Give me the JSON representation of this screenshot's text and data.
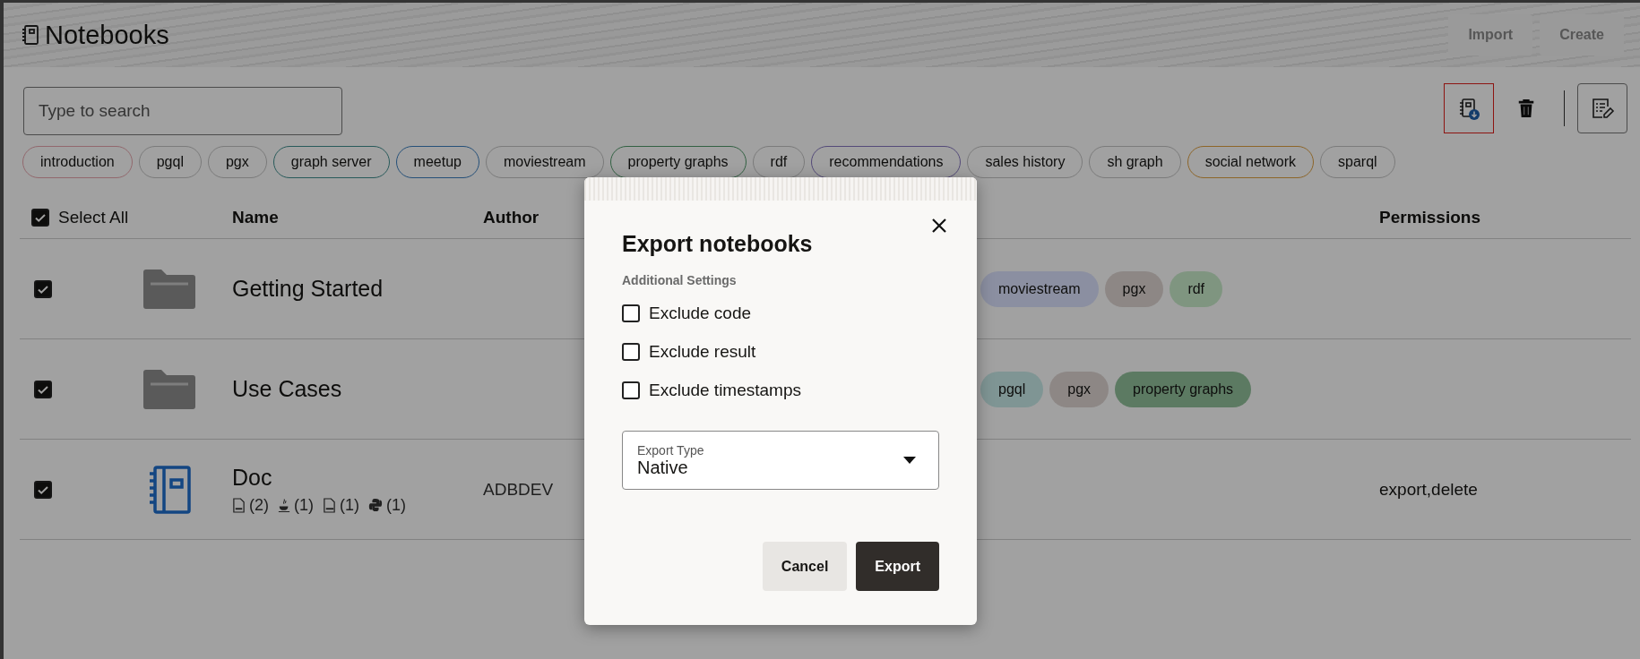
{
  "header": {
    "title": "Notebooks",
    "actions": [
      "Import",
      "Create"
    ]
  },
  "search": {
    "placeholder": "Type to search"
  },
  "toolbar": [
    {
      "kind": "export",
      "highlighted": true
    },
    {
      "kind": "delete",
      "highlighted": false
    },
    {
      "kind": "edit",
      "highlighted": false
    }
  ],
  "filter_tags": [
    {
      "label": "introduction",
      "color": "#92686d"
    },
    {
      "label": "pgql",
      "color": "#7b7b7b"
    },
    {
      "label": "pgx",
      "color": "#7b7b7b"
    },
    {
      "label": "graph server",
      "color": "#285a5a"
    },
    {
      "label": "meetup",
      "color": "#255079"
    },
    {
      "label": "moviestream",
      "color": "#7b7b7b"
    },
    {
      "label": "property graphs",
      "color": "#326142"
    },
    {
      "label": "rdf",
      "color": "#7b7b7b"
    },
    {
      "label": "recommendations",
      "color": "#544a79"
    },
    {
      "label": "sales history",
      "color": "#7b7b7b"
    },
    {
      "label": "sh graph",
      "color": "#7b7b7b"
    },
    {
      "label": "social network",
      "color": "#8d6528"
    },
    {
      "label": "sparql",
      "color": "#7b7b7b"
    }
  ],
  "table": {
    "select_all": {
      "label": "Select All",
      "checked": true
    },
    "columns": [
      "Name",
      "Author",
      "Permissions"
    ],
    "rows": [
      {
        "kind": "folder",
        "checked": true,
        "name": "Getting Started",
        "tags": [
          {
            "label": "moviestream",
            "color": "#8b8fa1"
          },
          {
            "label": "pgx",
            "color": "#8d8785"
          },
          {
            "label": "rdf",
            "color": "#7f9580"
          }
        ]
      },
      {
        "kind": "folder",
        "checked": true,
        "name": "Use Cases",
        "tags": [
          {
            "label": "pgql",
            "color": "#7f9594"
          },
          {
            "label": "pgx",
            "color": "#8d8785"
          },
          {
            "label": "property graphs",
            "color": "#5c7a62"
          }
        ]
      },
      {
        "kind": "notebook",
        "checked": true,
        "name": "Doc",
        "author": "ADBDEV",
        "permissions": "export,delete",
        "languages": [
          {
            "kind": "sql",
            "count": "(2)"
          },
          {
            "kind": "java",
            "count": "(1)"
          },
          {
            "kind": "pgql",
            "count": "(1)"
          },
          {
            "kind": "python",
            "count": "(1)"
          }
        ]
      }
    ]
  },
  "dialog": {
    "title": "Export notebooks",
    "section": "Additional Settings",
    "options": [
      {
        "label": "Exclude code",
        "checked": false
      },
      {
        "label": "Exclude result",
        "checked": false
      },
      {
        "label": "Exclude timestamps",
        "checked": false
      }
    ],
    "select": {
      "label": "Export Type",
      "value": "Native"
    },
    "buttons": [
      {
        "kind": "secondary",
        "label": "Cancel"
      },
      {
        "kind": "primary",
        "label": "Export"
      }
    ]
  }
}
